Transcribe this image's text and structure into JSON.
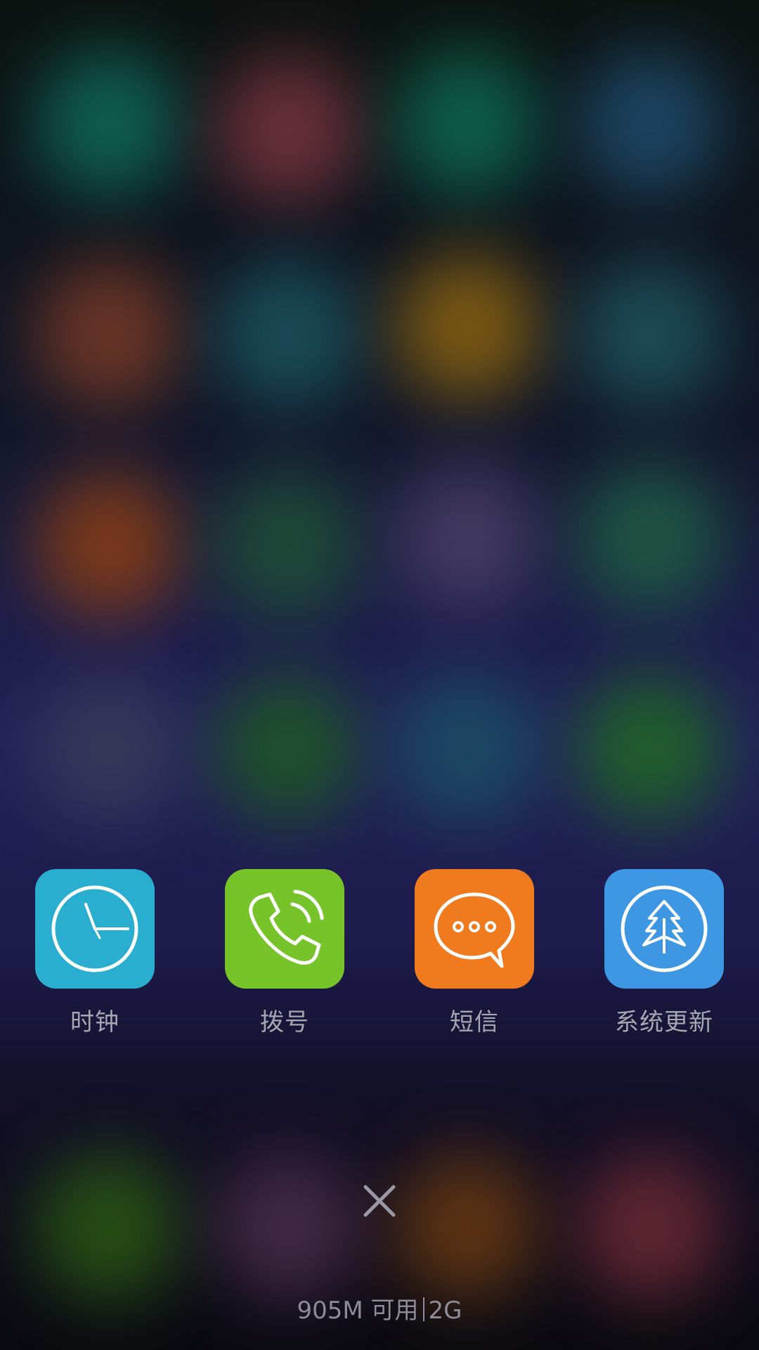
{
  "recent_apps": [
    {
      "label": "时钟",
      "icon": "clock-icon",
      "color": "#2aaed0"
    },
    {
      "label": "拨号",
      "icon": "phone-icon",
      "color": "#76c42a"
    },
    {
      "label": "短信",
      "icon": "message-icon",
      "color": "#f07a1e"
    },
    {
      "label": "系统更新",
      "icon": "system-update-icon",
      "color": "#3e97e3"
    }
  ],
  "close_button": {
    "icon": "close-icon"
  },
  "memory": {
    "available": "905M 可用",
    "total": "2G"
  }
}
